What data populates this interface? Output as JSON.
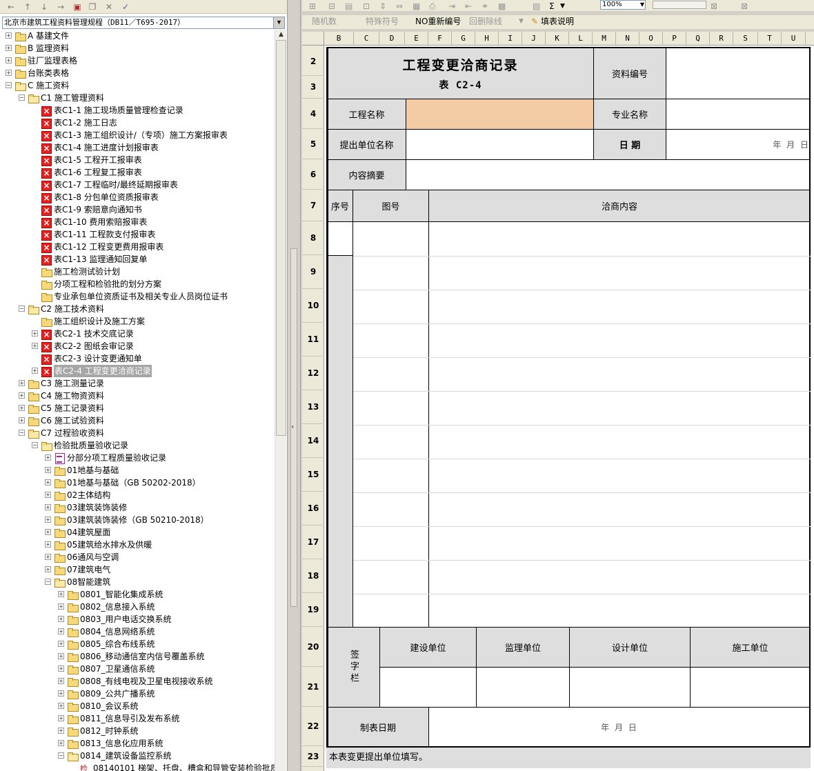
{
  "left_pane": {
    "toolbar": {
      "items": [
        "back-icon",
        "up-icon",
        "down-icon",
        "forward-icon",
        "new-doc-icon",
        "copy-icon",
        "delete-icon",
        "check-icon"
      ]
    },
    "spec_select": {
      "value": "北京市建筑工程资料管理规程（DB11／T695-2017）"
    },
    "tree": [
      {
        "label": "A 基建文件",
        "level": 0,
        "exp": "+",
        "icon": "folder"
      },
      {
        "label": "B 监理资料",
        "level": 0,
        "exp": "+",
        "icon": "folder"
      },
      {
        "label": "驻厂监理表格",
        "level": 0,
        "exp": "+",
        "icon": "folder"
      },
      {
        "label": "台账类表格",
        "level": 0,
        "exp": "+",
        "icon": "folder"
      },
      {
        "label": "C 施工资料",
        "level": 0,
        "exp": "-",
        "icon": "open"
      },
      {
        "label": "C1 施工管理资料",
        "level": 1,
        "exp": "-",
        "icon": "open"
      },
      {
        "label": "表C1-1 施工现场质量管理检查记录",
        "level": 2,
        "exp": "",
        "icon": "form"
      },
      {
        "label": "表C1-2 施工日志",
        "level": 2,
        "exp": "",
        "icon": "form"
      },
      {
        "label": "表C1-3 施工组织设计/（专项）施工方案报审表",
        "level": 2,
        "exp": "",
        "icon": "form"
      },
      {
        "label": "表C1-4 施工进度计划报审表",
        "level": 2,
        "exp": "",
        "icon": "form"
      },
      {
        "label": "表C1-5 工程开工报审表",
        "level": 2,
        "exp": "",
        "icon": "form"
      },
      {
        "label": "表C1-6 工程复工报审表",
        "level": 2,
        "exp": "",
        "icon": "form"
      },
      {
        "label": "表C1-7 工程临时/最终延期报审表",
        "level": 2,
        "exp": "",
        "icon": "form"
      },
      {
        "label": "表C1-8 分包单位资质报审表",
        "level": 2,
        "exp": "",
        "icon": "form"
      },
      {
        "label": "表C1-9 索赔意向通知书",
        "level": 2,
        "exp": "",
        "icon": "form"
      },
      {
        "label": "表C1-10 费用索赔报审表",
        "level": 2,
        "exp": "",
        "icon": "form"
      },
      {
        "label": "表C1-11 工程款支付报审表",
        "level": 2,
        "exp": "",
        "icon": "form"
      },
      {
        "label": "表C1-12 工程变更费用报审表",
        "level": 2,
        "exp": "",
        "icon": "form"
      },
      {
        "label": "表C1-13 监理通知回复单",
        "level": 2,
        "exp": "",
        "icon": "form"
      },
      {
        "label": "施工检测试验计划",
        "level": 2,
        "exp": "",
        "icon": "folder"
      },
      {
        "label": "分项工程和检验批的划分方案",
        "level": 2,
        "exp": "",
        "icon": "folder"
      },
      {
        "label": "专业承包单位资质证书及相关专业人员岗位证书",
        "level": 2,
        "exp": "",
        "icon": "folder"
      },
      {
        "label": "C2 施工技术资料",
        "level": 1,
        "exp": "-",
        "icon": "open"
      },
      {
        "label": "施工组织设计及施工方案",
        "level": 2,
        "exp": "",
        "icon": "folder"
      },
      {
        "label": "表C2-1 技术交底记录",
        "level": 2,
        "exp": "+",
        "icon": "form"
      },
      {
        "label": "表C2-2 图纸会审记录",
        "level": 2,
        "exp": "+",
        "icon": "form"
      },
      {
        "label": "表C2-3 设计变更通知单",
        "level": 2,
        "exp": "",
        "icon": "form"
      },
      {
        "label": "表C2-4 工程变更洽商记录",
        "level": 2,
        "exp": "+",
        "icon": "form",
        "selected": true
      },
      {
        "label": "C3 施工测量记录",
        "level": 1,
        "exp": "+",
        "icon": "folder"
      },
      {
        "label": "C4 施工物资资料",
        "level": 1,
        "exp": "+",
        "icon": "folder"
      },
      {
        "label": "C5 施工记录资料",
        "level": 1,
        "exp": "+",
        "icon": "folder"
      },
      {
        "label": "C6 施工试验资料",
        "level": 1,
        "exp": "+",
        "icon": "folder"
      },
      {
        "label": "C7 过程验收资料",
        "level": 1,
        "exp": "-",
        "icon": "open"
      },
      {
        "label": "检验批质量验收记录",
        "level": 2,
        "exp": "-",
        "icon": "open"
      },
      {
        "label": "分部分项工程质量验收记录",
        "level": 3,
        "exp": "+",
        "icon": "sheet"
      },
      {
        "label": "01地基与基础",
        "level": 3,
        "exp": "+",
        "icon": "folder"
      },
      {
        "label": "01地基与基础（GB 50202-2018）",
        "level": 3,
        "exp": "+",
        "icon": "folder"
      },
      {
        "label": "02主体结构",
        "level": 3,
        "exp": "+",
        "icon": "folder"
      },
      {
        "label": "03建筑装饰装修",
        "level": 3,
        "exp": "+",
        "icon": "folder"
      },
      {
        "label": "03建筑装饰装修（GB 50210-2018）",
        "level": 3,
        "exp": "+",
        "icon": "folder"
      },
      {
        "label": "04建筑屋面",
        "level": 3,
        "exp": "+",
        "icon": "folder"
      },
      {
        "label": "05建筑给水排水及供暖",
        "level": 3,
        "exp": "+",
        "icon": "folder"
      },
      {
        "label": "06通风与空调",
        "level": 3,
        "exp": "+",
        "icon": "folder"
      },
      {
        "label": "07建筑电气",
        "level": 3,
        "exp": "+",
        "icon": "folder"
      },
      {
        "label": "08智能建筑",
        "level": 3,
        "exp": "-",
        "icon": "open"
      },
      {
        "label": "0801_智能化集成系统",
        "level": 4,
        "exp": "+",
        "icon": "folder"
      },
      {
        "label": "0802_信息接入系统",
        "level": 4,
        "exp": "+",
        "icon": "folder"
      },
      {
        "label": "0803_用户电话交换系统",
        "level": 4,
        "exp": "+",
        "icon": "folder"
      },
      {
        "label": "0804_信息网络系统",
        "level": 4,
        "exp": "+",
        "icon": "folder"
      },
      {
        "label": "0805_综合布线系统",
        "level": 4,
        "exp": "+",
        "icon": "folder"
      },
      {
        "label": "0806_移动通信室内信号覆盖系统",
        "level": 4,
        "exp": "+",
        "icon": "folder"
      },
      {
        "label": "0807_卫星通信系统",
        "level": 4,
        "exp": "+",
        "icon": "folder"
      },
      {
        "label": "0808_有线电视及卫星电视接收系统",
        "level": 4,
        "exp": "+",
        "icon": "folder"
      },
      {
        "label": "0809_公共广播系统",
        "level": 4,
        "exp": "+",
        "icon": "folder"
      },
      {
        "label": "0810_会议系统",
        "level": 4,
        "exp": "+",
        "icon": "folder"
      },
      {
        "label": "0811_信息导引及发布系统",
        "level": 4,
        "exp": "+",
        "icon": "folder"
      },
      {
        "label": "0812_时钟系统",
        "level": 4,
        "exp": "+",
        "icon": "folder"
      },
      {
        "label": "0813_信息化应用系统",
        "level": 4,
        "exp": "+",
        "icon": "folder"
      },
      {
        "label": "0814_建筑设备监控系统",
        "level": 4,
        "exp": "-",
        "icon": "open"
      },
      {
        "label": "08140101 梯架、托盘、槽盒和导管安装检验批质",
        "level": 5,
        "exp": "",
        "icon": "doc"
      }
    ]
  },
  "toolbar2": {
    "random_label": "随机数",
    "special_label": "特殊符号",
    "renumber_label": "NO重新编号",
    "delete_row_label": "回删除线",
    "fill_help_label": "填表说明",
    "zoom_value": "100%",
    "sum_label": "Σ"
  },
  "grid": {
    "columns": [
      "B",
      "C",
      "D",
      "E",
      "F",
      "G",
      "H",
      "I",
      "J",
      "K",
      "L",
      "M",
      "N",
      "O",
      "P",
      "Q",
      "R",
      "S",
      "T",
      "U"
    ],
    "rows": [
      "2",
      "3",
      "4",
      "5",
      "6",
      "7",
      "8",
      "9",
      "10",
      "11",
      "12",
      "13",
      "14",
      "15",
      "16",
      "17",
      "18",
      "19",
      "20",
      "21",
      "22",
      "23"
    ]
  },
  "form": {
    "title": "工程变更洽商记录",
    "subtitle": "表 C2-4",
    "doc_no_label": "资料编号",
    "doc_no_value": "",
    "project_name_label": "工程名称",
    "project_name_value": "",
    "specialty_label": "专业名称",
    "specialty_value": "",
    "submitter_label": "提出单位名称",
    "submitter_value": "",
    "date_label": "日 期",
    "date_value": "年  月  日",
    "summary_label": "内容摘要",
    "summary_value": "",
    "col_seq": "序号",
    "col_drawing": "图号",
    "col_content": "洽商内容",
    "sign_label": "签字栏",
    "parties": [
      "建设单位",
      "监理单位",
      "设计单位",
      "施工单位"
    ],
    "table_date_label": "制表日期",
    "table_date_value": "年  月  日",
    "note": "本表变更提出单位填写。"
  }
}
